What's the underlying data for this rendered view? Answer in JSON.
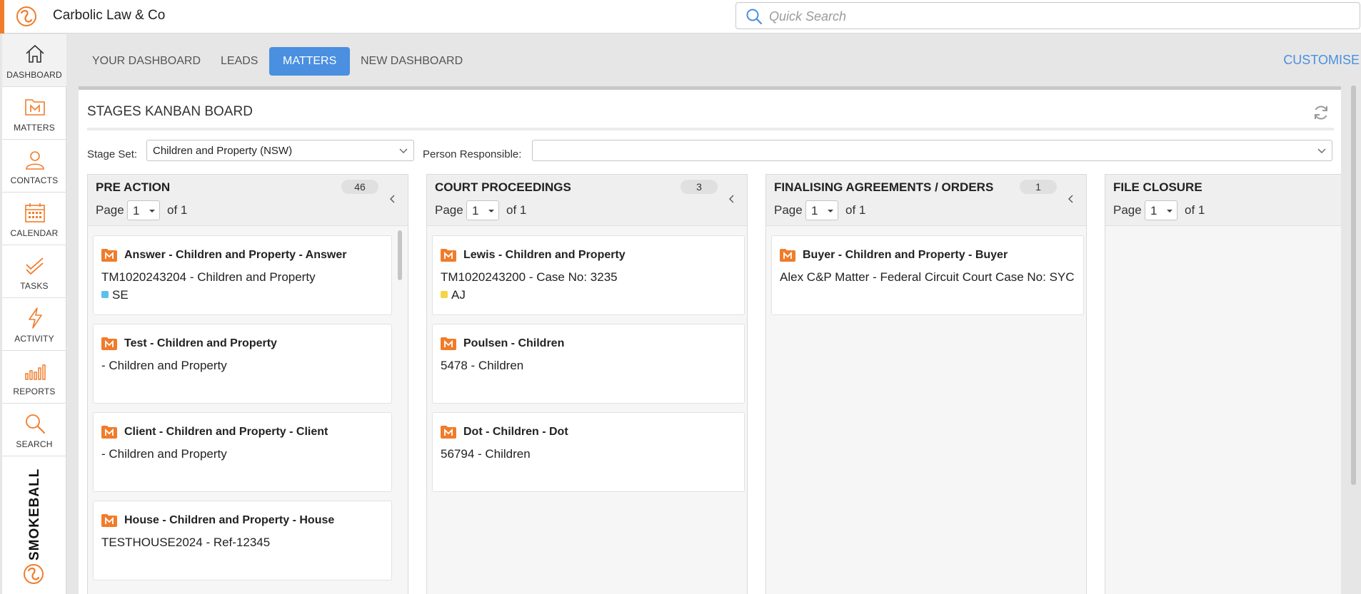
{
  "header": {
    "firm_name": "Carbolic Law & Co",
    "search_placeholder": "Quick Search",
    "brand_color": "#f07c2a"
  },
  "sidebar": {
    "items": [
      {
        "label": "DASHBOARD",
        "icon": "home-icon"
      },
      {
        "label": "MATTERS",
        "icon": "matters-icon"
      },
      {
        "label": "CONTACTS",
        "icon": "contacts-icon"
      },
      {
        "label": "CALENDAR",
        "icon": "calendar-icon"
      },
      {
        "label": "TASKS",
        "icon": "tasks-icon"
      },
      {
        "label": "ACTIVITY",
        "icon": "activity-icon"
      },
      {
        "label": "REPORTS",
        "icon": "reports-icon"
      },
      {
        "label": "SEARCH",
        "icon": "search-icon"
      }
    ],
    "brand": "SMOKEBALL"
  },
  "tabs": [
    {
      "label": "YOUR DASHBOARD",
      "active": false
    },
    {
      "label": "LEADS",
      "active": false
    },
    {
      "label": "MATTERS",
      "active": true
    },
    {
      "label": "NEW DASHBOARD",
      "active": false
    }
  ],
  "customise_label": "CUSTOMISE",
  "board": {
    "title": "STAGES KANBAN BOARD",
    "stage_set_label": "Stage Set:",
    "stage_set_value": "Children and Property (NSW)",
    "person_label": "Person Responsible:",
    "person_value": "",
    "page_label": "Page",
    "columns": [
      {
        "title": "PRE ACTION",
        "count": "46",
        "page": "1",
        "of": "of 1",
        "cards": [
          {
            "title": "Answer - Children and Property - Answer",
            "sub": "TM1020243204 - Children and Property",
            "tag": "SE",
            "tag_color": "#5bc0eb"
          },
          {
            "title": "Test - Children and Property",
            "sub": " - Children and Property",
            "tag": "",
            "tag_color": ""
          },
          {
            "title": "Client - Children and Property - Client",
            "sub": " - Children and Property",
            "tag": "",
            "tag_color": ""
          },
          {
            "title": "House - Children and Property - House",
            "sub": "TESTHOUSE2024 - Ref-12345",
            "tag": "",
            "tag_color": ""
          }
        ]
      },
      {
        "title": "COURT PROCEEDINGS",
        "count": "3",
        "page": "1",
        "of": "of 1",
        "cards": [
          {
            "title": "Lewis - Children and Property",
            "sub": "TM1020243200 - Case No: 3235",
            "tag": "AJ",
            "tag_color": "#f5d547"
          },
          {
            "title": "Poulsen - Children",
            "sub": "5478 - Children",
            "tag": "",
            "tag_color": ""
          },
          {
            "title": "Dot - Children - Dot",
            "sub": "56794 - Children",
            "tag": "",
            "tag_color": ""
          }
        ]
      },
      {
        "title": "FINALISING AGREEMENTS / ORDERS",
        "count": "1",
        "page": "1",
        "of": "of 1",
        "cards": [
          {
            "title": "Buyer - Children and Property - Buyer",
            "sub": "Alex C&P Matter - Federal Circuit Court Case No: SYC",
            "tag": "",
            "tag_color": ""
          }
        ]
      },
      {
        "title": "FILE CLOSURE",
        "count": "",
        "page": "1",
        "of": "of 1",
        "cards": []
      }
    ]
  }
}
